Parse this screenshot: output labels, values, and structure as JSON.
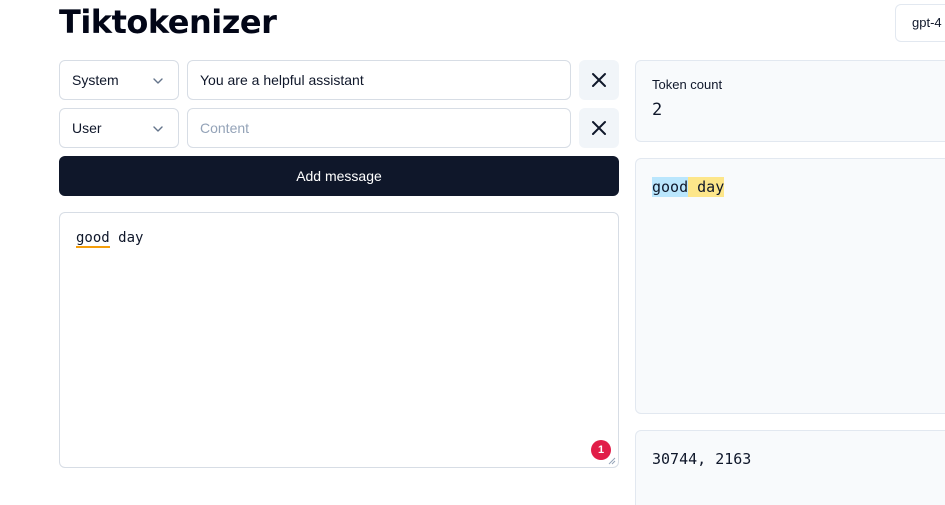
{
  "app": {
    "title": "Tiktokenizer"
  },
  "model_select": {
    "value": "gpt-4"
  },
  "messages": [
    {
      "role": "System",
      "content": "You are a helpful assistant",
      "placeholder": "Content"
    },
    {
      "role": "User",
      "content": "",
      "placeholder": "Content"
    }
  ],
  "add_button": {
    "label": "Add message"
  },
  "editor": {
    "words": [
      "good",
      " day"
    ],
    "badge": "1"
  },
  "token_panel": {
    "label": "Token count",
    "count": "2"
  },
  "tokens_view": {
    "tokens": [
      "good",
      " day"
    ]
  },
  "token_ids": {
    "text": "30744, 2163"
  },
  "colors": {
    "primary": "#0f172a",
    "badge": "#e11d48",
    "token_blue": "#bae6fd",
    "token_yellow": "#fde68a",
    "underline": "#f59e0b"
  },
  "icons": {
    "chevron": "chevron-down-icon",
    "close": "close-icon"
  }
}
